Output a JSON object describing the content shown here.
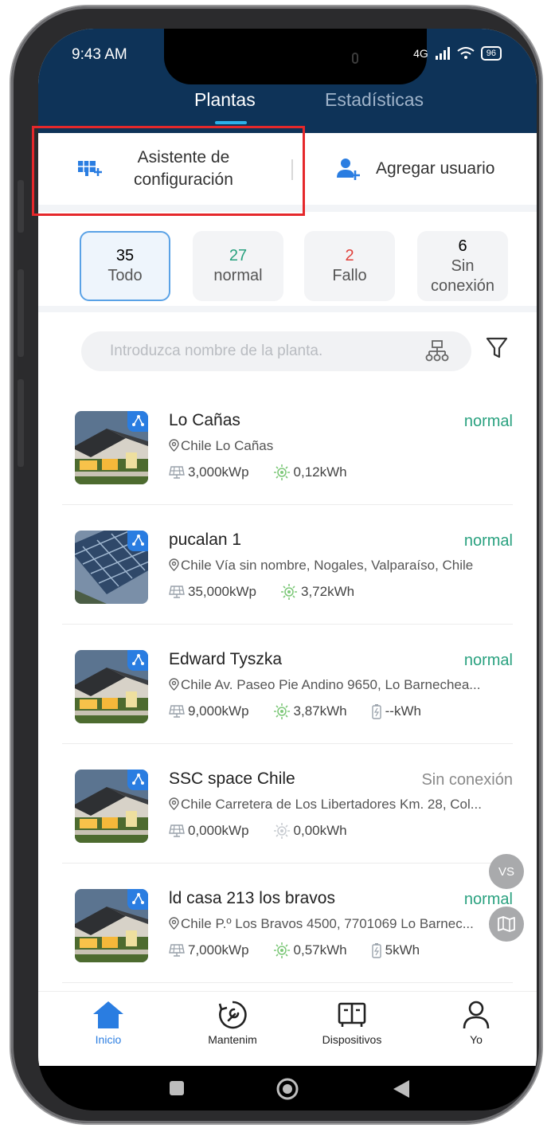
{
  "status_bar": {
    "time": "9:43 AM",
    "network": "4G",
    "battery": "96"
  },
  "header_tabs": [
    {
      "label": "Plantas",
      "active": true
    },
    {
      "label": "Estadísticas",
      "active": false
    }
  ],
  "quick_actions": {
    "wizard_line1": "Asistente de",
    "wizard_line2": "configuración",
    "add_user": "Agregar usuario"
  },
  "filters": [
    {
      "count": "35",
      "label": "Todo",
      "color": "#222222",
      "active": true
    },
    {
      "count": "27",
      "label": "normal",
      "color": "#29a17f",
      "active": false
    },
    {
      "count": "2",
      "label": "Fallo",
      "color": "#e0403a",
      "active": false
    },
    {
      "count": "6",
      "label": "Sin conexión",
      "color": "#222222",
      "active": false
    }
  ],
  "search": {
    "placeholder": "Introduzca nombre de la planta."
  },
  "plants": [
    {
      "name": "Lo Cañas",
      "status": "normal",
      "address": "Chile Lo Cañas",
      "capacity": "3,000kWp",
      "energy": "0,12kWh",
      "battery": "",
      "image": "house"
    },
    {
      "name": "pucalan 1",
      "status": "normal",
      "address": "Chile Vía sin nombre, Nogales, Valparaíso, Chile",
      "capacity": "35,000kWp",
      "energy": "3,72kWh",
      "battery": "",
      "image": "panels"
    },
    {
      "name": "Edward Tyszka",
      "status": "normal",
      "address": "Chile Av. Paseo Pie Andino 9650, Lo Barnechea...",
      "capacity": "9,000kWp",
      "energy": "3,87kWh",
      "battery": "--kWh",
      "image": "house"
    },
    {
      "name": "SSC space Chile",
      "status": "Sin conexión",
      "address": "Chile Carretera de Los Libertadores Km. 28, Col...",
      "capacity": "0,000kWp",
      "energy": "0,00kWh",
      "battery": "",
      "image": "house"
    },
    {
      "name": "ld casa 213 los bravos",
      "status": "normal",
      "address": "Chile P.º Los Bravos 4500, 7701069 Lo Barnec...",
      "capacity": "7,000kWp",
      "energy": "0,57kWh",
      "battery": "5kWh",
      "image": "house"
    }
  ],
  "floating": {
    "vs": "VS"
  },
  "bottom_nav": [
    {
      "label": "Inicio",
      "icon": "home-icon",
      "active": true
    },
    {
      "label": "Mantenim",
      "icon": "wrench-icon",
      "active": false
    },
    {
      "label": "Dispositivos",
      "icon": "devices-icon",
      "active": false
    },
    {
      "label": "Yo",
      "icon": "user-icon",
      "active": false
    }
  ],
  "colors": {
    "header": "#0e3358",
    "accent": "#2a7de1",
    "normal": "#29a17f",
    "fault": "#e0403a",
    "highlight_box": "#e5282b"
  }
}
